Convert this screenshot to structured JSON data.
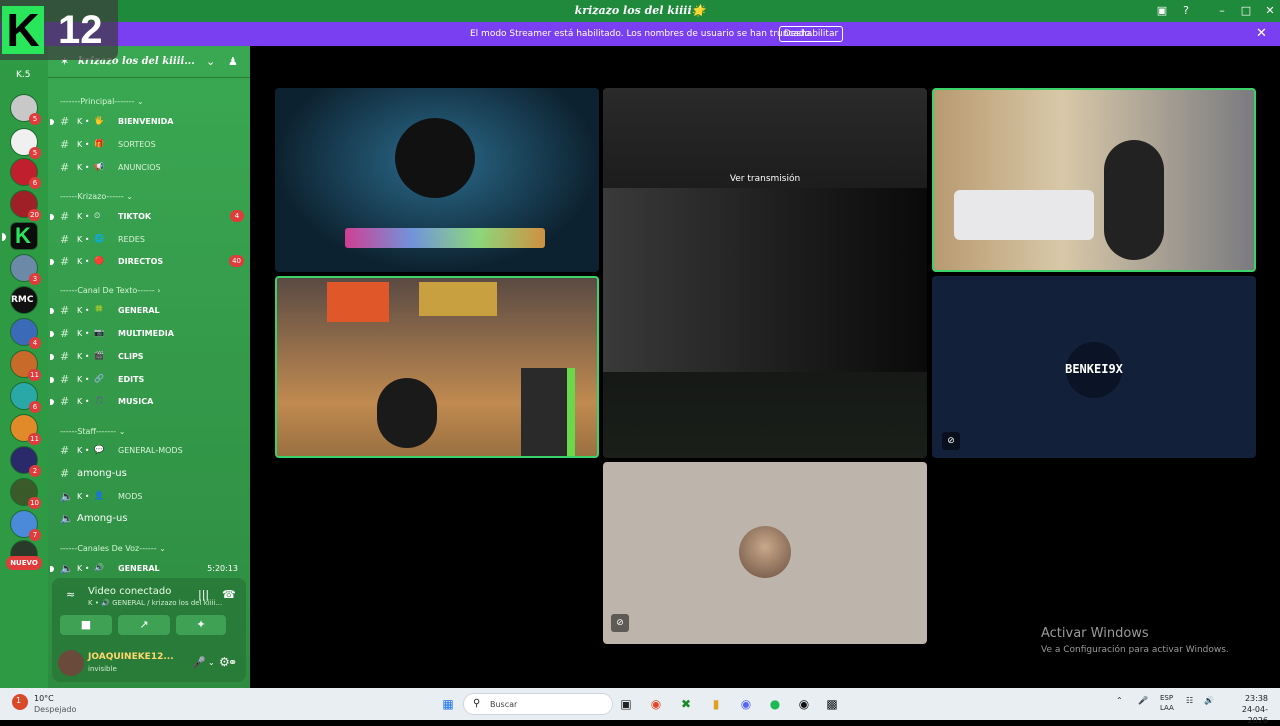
{
  "window": {
    "title": "krizazo los del kiiii🌟"
  },
  "streamer_bar": {
    "message": "El modo Streamer está habilitado. Los nombres de usuario se han truncado.",
    "button": "Deshabilitar"
  },
  "overlay_logo": {
    "letter": "K",
    "number": "12"
  },
  "guild_rail": {
    "top_label": "K.5",
    "badges": [
      "5",
      "3",
      "5",
      "6",
      "20",
      "",
      "3",
      "",
      "4",
      "11",
      "6",
      "11",
      "2",
      "10",
      "7",
      ""
    ],
    "new_label": "NUEVO"
  },
  "server": {
    "name": "krizazo los del kiiii..."
  },
  "categories": {
    "principal": "-------Principal------- ⌄",
    "krizazo": "------Krizazo------ ⌄",
    "canal_texto": "------Canal De Texto------ ›",
    "staff": "------Staff------- ⌄",
    "canales_voz": "------Canales De Voz------ ⌄"
  },
  "channels": [
    {
      "k": "K •",
      "emoji": "🖐",
      "name": "BIENVENIDA",
      "count": ""
    },
    {
      "k": "K •",
      "emoji": "🎁",
      "name": "SORTEOS",
      "count": ""
    },
    {
      "k": "K •",
      "emoji": "📢",
      "name": "ANUNCIOS",
      "count": ""
    },
    {
      "k": "K •",
      "emoji": "⏲",
      "name": "TIKTOK",
      "count": "4"
    },
    {
      "k": "K •",
      "emoji": "🌐",
      "name": "REDES",
      "count": ""
    },
    {
      "k": "K •",
      "emoji": "🔴",
      "name": "DIRECTOS",
      "count": "40"
    },
    {
      "k": "K •",
      "emoji": "🍀",
      "name": "GENERAL",
      "count": ""
    },
    {
      "k": "K •",
      "emoji": "📷",
      "name": "MULTIMEDIA",
      "count": ""
    },
    {
      "k": "K •",
      "emoji": "🎬",
      "name": "CLIPS",
      "count": ""
    },
    {
      "k": "K •",
      "emoji": "🔗",
      "name": "EDITS",
      "count": ""
    },
    {
      "k": "K •",
      "emoji": "🎵",
      "name": "MUSICA",
      "count": ""
    },
    {
      "k": "K •",
      "emoji": "💬",
      "name": "GENERAL-MODS",
      "count": ""
    },
    {
      "k": "",
      "emoji": "",
      "name": "among-us",
      "count": ""
    },
    {
      "k": "K •",
      "emoji": "👤",
      "name": "MODS",
      "count": ""
    },
    {
      "k": "",
      "emoji": "",
      "name": "Among-us",
      "count": ""
    },
    {
      "k": "K •",
      "emoji": "🔊",
      "name": "GENERAL",
      "count": "",
      "time": "5:20:13"
    }
  ],
  "voice_panel": {
    "title": "Video conectado",
    "subtitle": "K • 🔊 GENERAL / krizazo los del kiiii..."
  },
  "user": {
    "name": "JOAQUINEKE12...",
    "status": "invisible"
  },
  "stage": {
    "stream_label": "Ver transmisión",
    "benk_name": "BENKEI9X"
  },
  "watermark": {
    "title": "Activar Windows",
    "sub": "Ve a Configuración para activar Windows."
  },
  "taskbar": {
    "temp": "10°C",
    "weather": "Despejado",
    "weather_badge": "1",
    "search_placeholder": "Buscar",
    "lang_top": "ESP",
    "lang_bottom": "LAA",
    "time": "23:38",
    "date": "24-04-2026"
  },
  "colors": {
    "accent_green": "#3aa853",
    "streamer_purple": "#7b3ff2",
    "speaking": "#3ad36a",
    "badge_red": "#e03c3c"
  }
}
